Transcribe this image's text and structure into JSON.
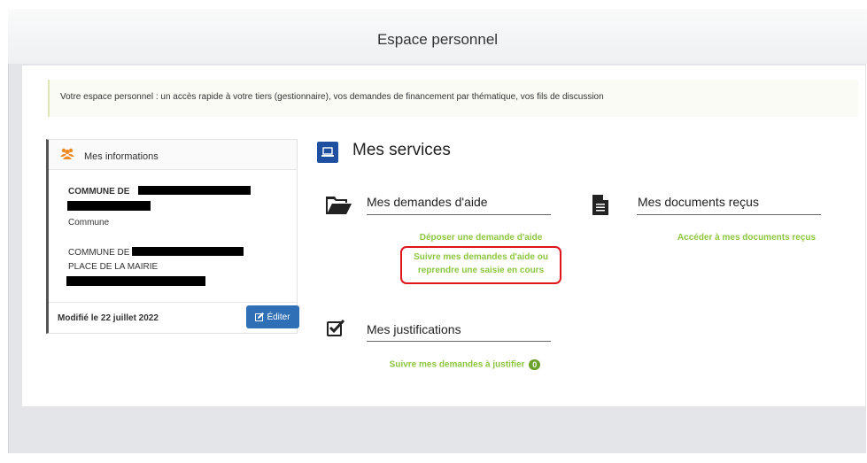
{
  "header": {
    "title": "Espace personnel"
  },
  "banner": {
    "text": "Votre espace personnel : un accès rapide à votre tiers (gestionnaire), vos demandes de financement par thématique, vos fils de discussion"
  },
  "info_card": {
    "title": "Mes informations",
    "icon": "users-icon",
    "commune_prefix": "COMMUNE DE",
    "type": "Commune",
    "address_prefix": "COMMUNE DE",
    "address_line": "PLACE DE LA MAIRIE",
    "modified": "Modifié le 22 juillet 2022",
    "edit_label": "Éditer"
  },
  "services": {
    "title": "Mes services",
    "aid": {
      "title": "Mes demandes d'aide",
      "icon": "folder-open-icon",
      "link1": "Déposer une demande d'aide",
      "link2_line1": "Suivre mes demandes d'aide ou",
      "link2_line2": "reprendre une saisie en cours"
    },
    "documents": {
      "title": "Mes documents reçus",
      "icon": "document-icon",
      "link": "Accéder à mes documents reçus"
    },
    "justifications": {
      "title": "Mes justifications",
      "icon": "checkbox-icon",
      "link": "Suivre mes demandes à justifier",
      "count": "0"
    }
  },
  "colors": {
    "link_green": "#8cc63f",
    "edit_blue": "#2e6fb6",
    "highlight_red": "#e0141b",
    "services_blue": "#1f4fa0"
  }
}
